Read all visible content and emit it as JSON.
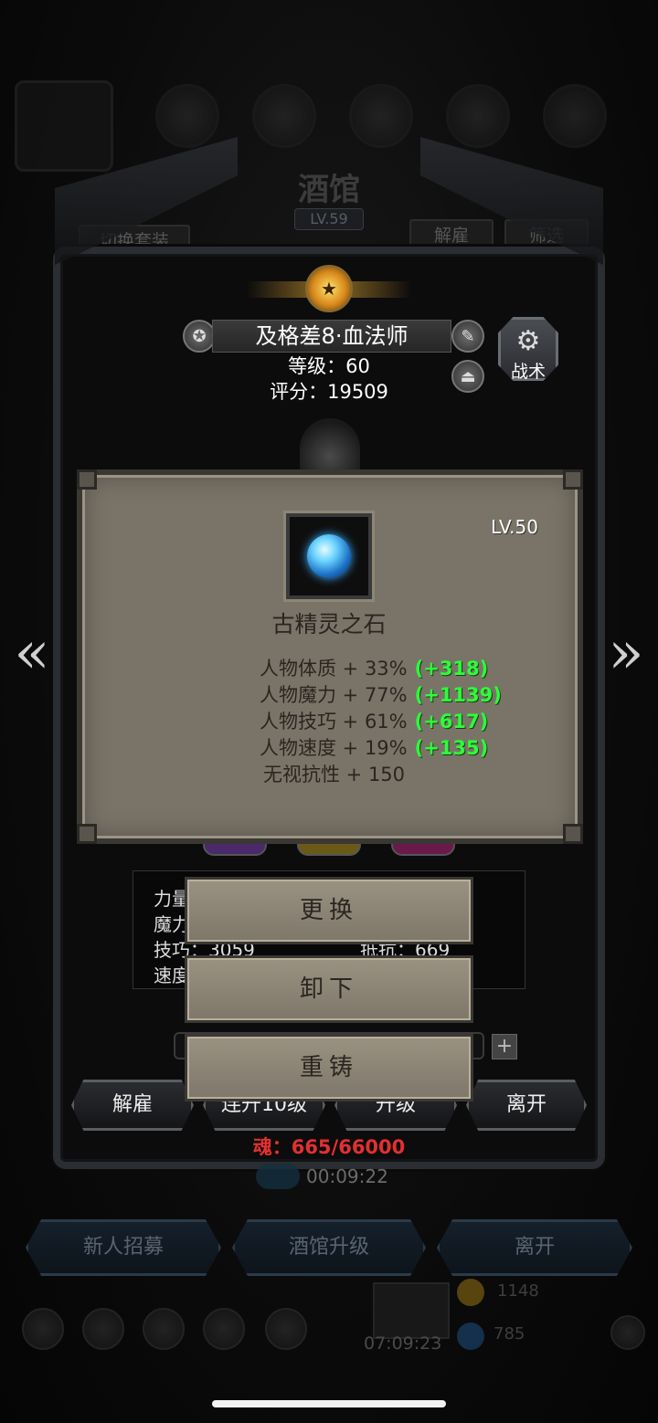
{
  "tavern": {
    "title": "酒馆",
    "level": "LV.59",
    "switch_set": "切换套装",
    "dismiss": "解雇",
    "filter": "筛选"
  },
  "hero": {
    "name": "及格差8·血法师",
    "level_line": "等级：60",
    "score_line": "评分：19509",
    "tactic": "战术"
  },
  "item": {
    "level": "LV.50",
    "name": "古精灵之石",
    "attributes": [
      {
        "text": "人物体质 + 33%",
        "bonus": "(+318)"
      },
      {
        "text": "人物魔力 + 77%",
        "bonus": "(+1139)"
      },
      {
        "text": "人物技巧 + 61%",
        "bonus": "(+617)"
      },
      {
        "text": "人物速度 + 19%",
        "bonus": "(+135)"
      },
      {
        "text": "无视抗性 + 150",
        "bonus": ""
      }
    ]
  },
  "stats_panel": {
    "lines": [
      "力量",
      "魔力",
      "技巧：3059",
      "速度"
    ],
    "right": "抵抗：669"
  },
  "menu": {
    "replace": "更换",
    "unequip": "卸下",
    "reforge": "重铸"
  },
  "frame_buttons": {
    "dismiss": "解雇",
    "upgrade10": "连升10级",
    "upgrade": "升级",
    "leave": "离开"
  },
  "soul": "魂：665/66000",
  "timer_top": "00:09:22",
  "bottom": {
    "recruit": "新人招募",
    "tavern_upgrade": "酒馆升级",
    "leave": "离开",
    "timer": "07:09:23",
    "gold": "1148",
    "gems": "785"
  }
}
